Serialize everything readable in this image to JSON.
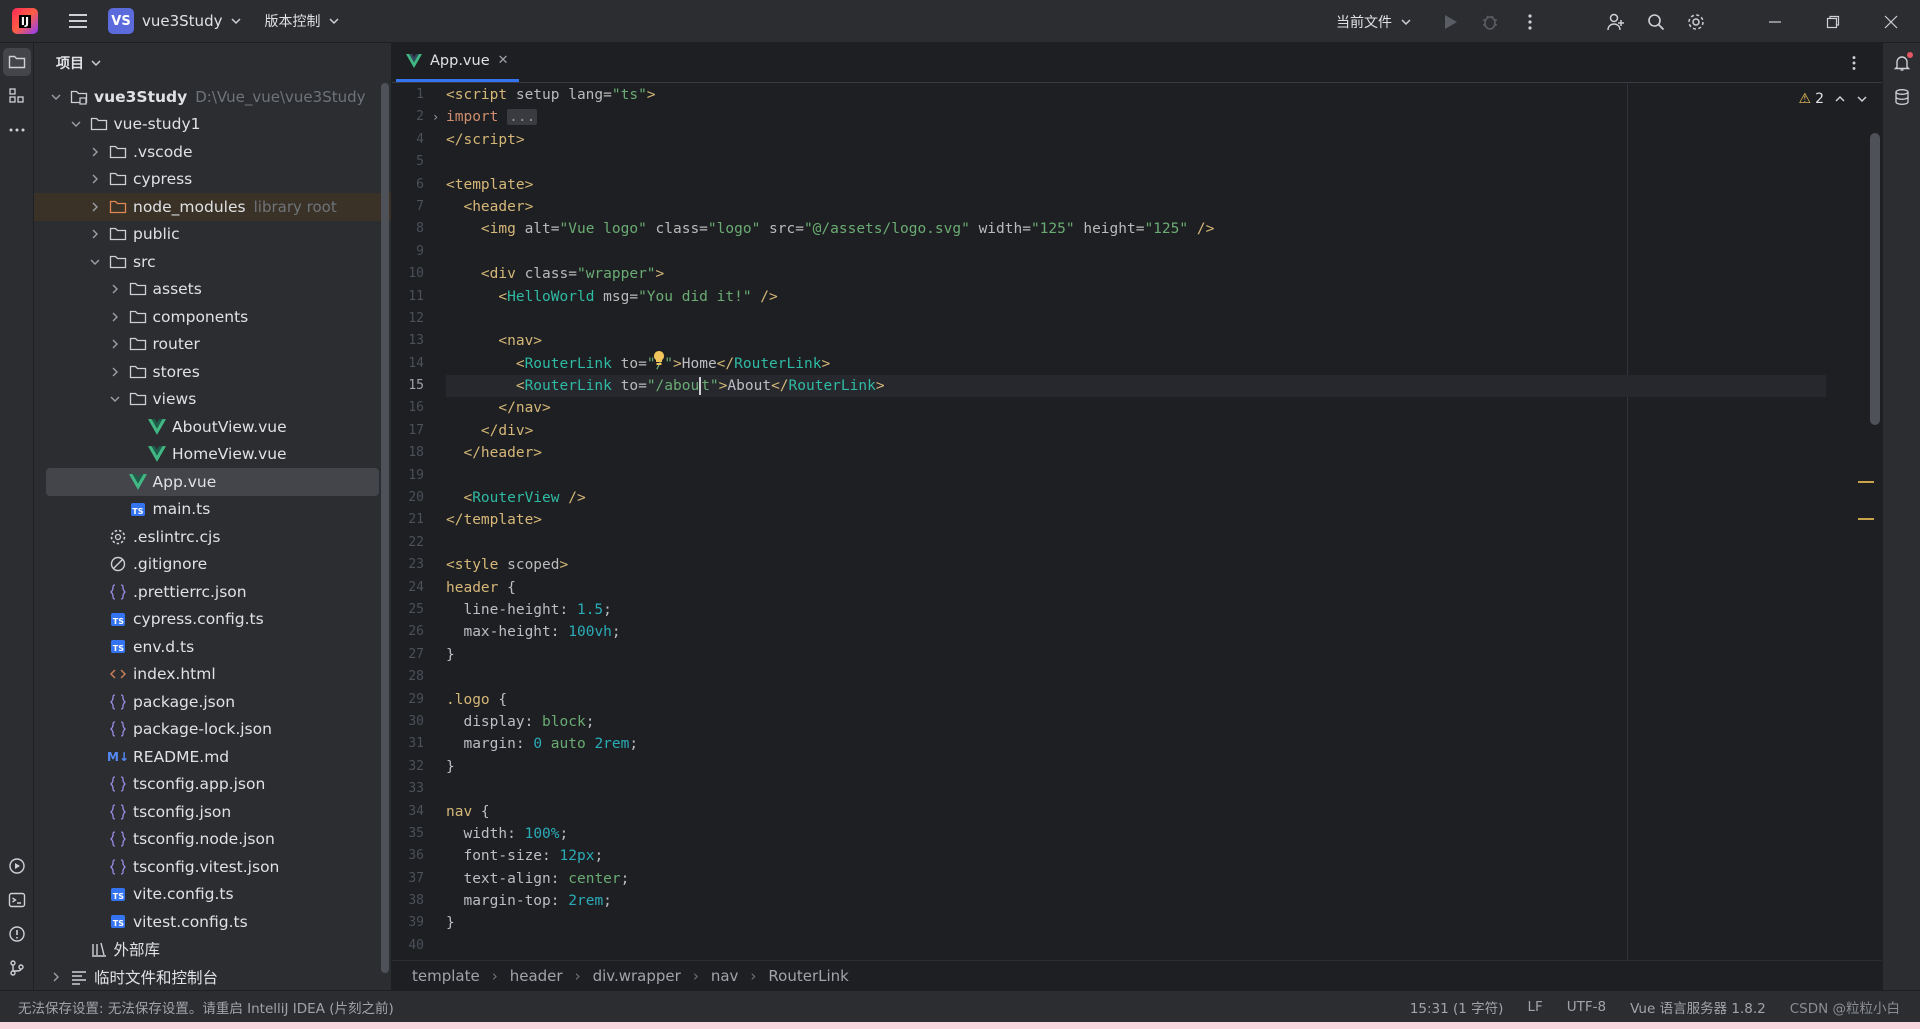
{
  "titlebar": {
    "project_badge": "VS",
    "project_name": "vue3Study",
    "vcs_label": "版本控制",
    "run_config": "当前文件"
  },
  "project_panel": {
    "title": "项目",
    "tree": [
      {
        "label": "vue3Study",
        "hint": "D:\\Vue_vue\\vue3Study",
        "indent": 0,
        "arrow": "down",
        "icon": "module",
        "bold": true
      },
      {
        "label": "vue-study1",
        "hint": "",
        "indent": 1,
        "arrow": "down",
        "icon": "folder"
      },
      {
        "label": ".vscode",
        "hint": "",
        "indent": 2,
        "arrow": "right",
        "icon": "folder"
      },
      {
        "label": "cypress",
        "hint": "",
        "indent": 2,
        "arrow": "right",
        "icon": "folder"
      },
      {
        "label": "node_modules",
        "hint": "library root",
        "indent": 2,
        "arrow": "right",
        "icon": "folder-orange",
        "library": true
      },
      {
        "label": "public",
        "hint": "",
        "indent": 2,
        "arrow": "right",
        "icon": "folder"
      },
      {
        "label": "src",
        "hint": "",
        "indent": 2,
        "arrow": "down",
        "icon": "folder"
      },
      {
        "label": "assets",
        "hint": "",
        "indent": 3,
        "arrow": "right",
        "icon": "folder"
      },
      {
        "label": "components",
        "hint": "",
        "indent": 3,
        "arrow": "right",
        "icon": "folder"
      },
      {
        "label": "router",
        "hint": "",
        "indent": 3,
        "arrow": "right",
        "icon": "folder"
      },
      {
        "label": "stores",
        "hint": "",
        "indent": 3,
        "arrow": "right",
        "icon": "folder"
      },
      {
        "label": "views",
        "hint": "",
        "indent": 3,
        "arrow": "down",
        "icon": "folder"
      },
      {
        "label": "AboutView.vue",
        "hint": "",
        "indent": 4,
        "arrow": "none",
        "icon": "vue"
      },
      {
        "label": "HomeView.vue",
        "hint": "",
        "indent": 4,
        "arrow": "none",
        "icon": "vue"
      },
      {
        "label": "App.vue",
        "hint": "",
        "indent": 3,
        "arrow": "none",
        "icon": "vue",
        "selected": true
      },
      {
        "label": "main.ts",
        "hint": "",
        "indent": 3,
        "arrow": "none",
        "icon": "ts"
      },
      {
        "label": ".eslintrc.cjs",
        "hint": "",
        "indent": 2,
        "arrow": "none",
        "icon": "gear"
      },
      {
        "label": ".gitignore",
        "hint": "",
        "indent": 2,
        "arrow": "none",
        "icon": "ignore"
      },
      {
        "label": ".prettierrc.json",
        "hint": "",
        "indent": 2,
        "arrow": "none",
        "icon": "json"
      },
      {
        "label": "cypress.config.ts",
        "hint": "",
        "indent": 2,
        "arrow": "none",
        "icon": "ts"
      },
      {
        "label": "env.d.ts",
        "hint": "",
        "indent": 2,
        "arrow": "none",
        "icon": "ts"
      },
      {
        "label": "index.html",
        "hint": "",
        "indent": 2,
        "arrow": "none",
        "icon": "html"
      },
      {
        "label": "package.json",
        "hint": "",
        "indent": 2,
        "arrow": "none",
        "icon": "json"
      },
      {
        "label": "package-lock.json",
        "hint": "",
        "indent": 2,
        "arrow": "none",
        "icon": "json"
      },
      {
        "label": "README.md",
        "hint": "",
        "indent": 2,
        "arrow": "none",
        "icon": "md"
      },
      {
        "label": "tsconfig.app.json",
        "hint": "",
        "indent": 2,
        "arrow": "none",
        "icon": "json"
      },
      {
        "label": "tsconfig.json",
        "hint": "",
        "indent": 2,
        "arrow": "none",
        "icon": "json"
      },
      {
        "label": "tsconfig.node.json",
        "hint": "",
        "indent": 2,
        "arrow": "none",
        "icon": "json"
      },
      {
        "label": "tsconfig.vitest.json",
        "hint": "",
        "indent": 2,
        "arrow": "none",
        "icon": "json"
      },
      {
        "label": "vite.config.ts",
        "hint": "",
        "indent": 2,
        "arrow": "none",
        "icon": "ts"
      },
      {
        "label": "vitest.config.ts",
        "hint": "",
        "indent": 2,
        "arrow": "none",
        "icon": "ts"
      },
      {
        "label": "外部库",
        "hint": "",
        "indent": 1,
        "arrow": "none",
        "icon": "library"
      },
      {
        "label": "临时文件和控制台",
        "hint": "",
        "indent": 0,
        "arrow": "right",
        "icon": "scratch"
      }
    ]
  },
  "editor": {
    "tab_label": "App.vue",
    "warning_count": "2",
    "current_line": 15,
    "line_numbers": [
      "1",
      "2",
      "4",
      "5",
      "6",
      "7",
      "8",
      "9",
      "10",
      "11",
      "12",
      "13",
      "14",
      "15",
      "16",
      "17",
      "18",
      "19",
      "20",
      "21",
      "22",
      "23",
      "24",
      "25",
      "26",
      "27",
      "28",
      "29",
      "30",
      "31",
      "32",
      "33",
      "34",
      "35",
      "36",
      "37",
      "38",
      "39",
      "40"
    ]
  },
  "breadcrumbs": [
    "template",
    "header",
    "div.wrapper",
    "nav",
    "RouterLink"
  ],
  "statusbar": {
    "message": "无法保存设置: 无法保存设置。请重启 IntelliJ IDEA (片刻之前)",
    "position": "15:31 (1 字符)",
    "line_sep": "LF",
    "encoding": "UTF-8",
    "language_server": "Vue 语言服务器 1.8.2",
    "watermark": "CSDN @粒粒小白"
  },
  "colors": {
    "accent": "#3574f0",
    "vue_green": "#41b883",
    "warning": "#f2c55c"
  }
}
